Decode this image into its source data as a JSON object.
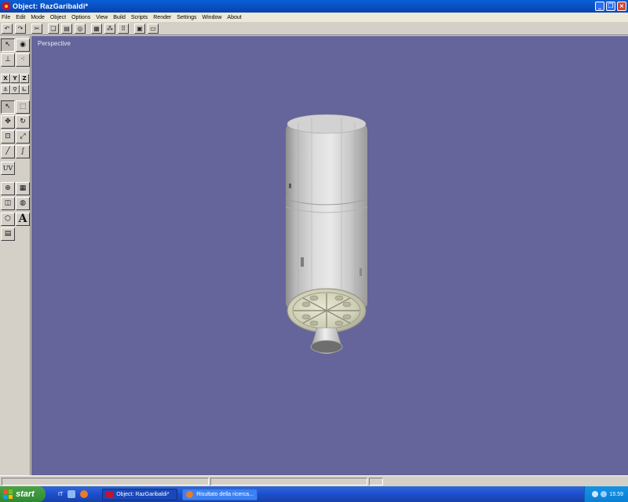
{
  "window": {
    "title": "Object: RazGaribaldi*"
  },
  "menu": [
    "File",
    "Edit",
    "Mode",
    "Object",
    "Options",
    "View",
    "Build",
    "Scripts",
    "Render",
    "Settings",
    "Window",
    "About"
  ],
  "toolbar": {
    "icons": [
      "undo-icon",
      "redo-icon",
      "cut-icon",
      "copy-icon",
      "paste-icon",
      "sphere-icon",
      "grid-icon",
      "point-cloud-icon",
      "vertex-icon",
      "render-icon",
      "image-icon"
    ]
  },
  "tools": {
    "axis_x": "X",
    "axis_y": "Y",
    "axis_z": "Z",
    "uv_label": "UV",
    "text_tool_label": "A"
  },
  "viewport": {
    "label": "Perspective",
    "background": "#65659b"
  },
  "taskbar": {
    "start_label": "start",
    "language": "IT",
    "tasks": [
      {
        "label": "Object: RazGaribaldi*"
      },
      {
        "label": "Risultato della ricerca..."
      }
    ],
    "clock": "15.59"
  }
}
